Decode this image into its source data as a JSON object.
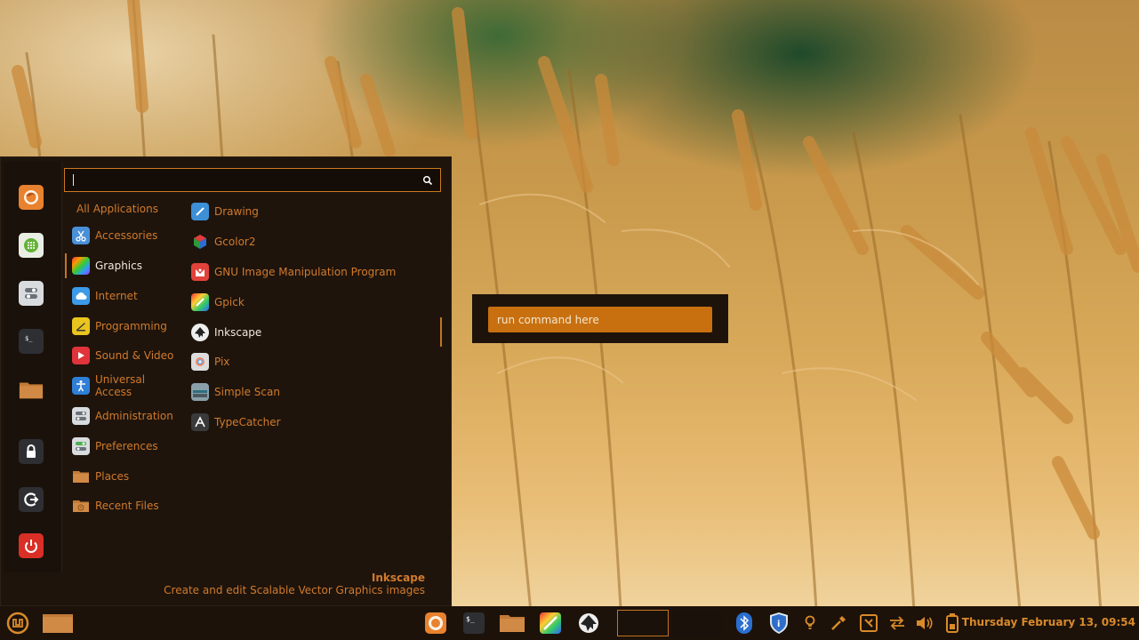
{
  "menu": {
    "search": {
      "value": "",
      "placeholder": ""
    },
    "categories": [
      {
        "label": "All Applications",
        "icon": "none",
        "active": false
      },
      {
        "label": "Accessories",
        "icon": "scissors-icon",
        "active": false
      },
      {
        "label": "Graphics",
        "icon": "graphics-icon",
        "active": true
      },
      {
        "label": "Internet",
        "icon": "cloud-icon",
        "active": false
      },
      {
        "label": "Programming",
        "icon": "programming-icon",
        "active": false
      },
      {
        "label": "Sound & Video",
        "icon": "play-icon",
        "active": false
      },
      {
        "label": "Universal Access",
        "icon": "accessibility-icon",
        "active": false
      },
      {
        "label": "Administration",
        "icon": "admin-toggles-icon",
        "active": false
      },
      {
        "label": "Preferences",
        "icon": "preferences-toggles-icon",
        "active": false
      },
      {
        "label": "Places",
        "icon": "folder-icon",
        "active": false
      },
      {
        "label": "Recent Files",
        "icon": "recent-folder-icon",
        "active": false
      }
    ],
    "apps": [
      {
        "label": "Drawing",
        "icon": "drawing-icon"
      },
      {
        "label": "Gcolor2",
        "icon": "gcolor2-cube-icon"
      },
      {
        "label": "GNU Image Manipulation Program",
        "icon": "gimp-icon"
      },
      {
        "label": "Gpick",
        "icon": "gpick-icon"
      },
      {
        "label": "Inkscape",
        "icon": "inkscape-icon",
        "selected": true
      },
      {
        "label": "Pix",
        "icon": "pix-icon"
      },
      {
        "label": "Simple Scan",
        "icon": "scanner-icon"
      },
      {
        "label": "TypeCatcher",
        "icon": "typecatcher-icon"
      }
    ],
    "favorites": [
      "firefox-icon",
      "software-manager-icon",
      "system-settings-icon",
      "terminal-icon",
      "files-folder-icon",
      "lock-screen-icon",
      "logout-icon",
      "shutdown-icon"
    ],
    "description": {
      "name": "Inkscape",
      "text": "Create and edit Scalable Vector Graphics images"
    }
  },
  "run_dialog": {
    "placeholder": "run command here"
  },
  "panel": {
    "clock": "Thursday February 13, 09:54",
    "launchers": [
      "menu-mint-icon",
      "show-desktop-folder-icon",
      "firefox-icon",
      "terminal-icon",
      "files-folder-icon",
      "color-app-icon",
      "inkscape-icon"
    ],
    "tray": [
      "bluetooth-icon",
      "update-shield-icon",
      "redshift-bulb-icon",
      "color-picker-icon",
      "screenshot-icon",
      "network-arrows-icon",
      "volume-icon",
      "battery-icon"
    ]
  },
  "colors": {
    "accent": "#c8700f",
    "menu_bg": "#1e140c",
    "text_orange": "#d17a2c",
    "text_active": "#f1e7dd"
  }
}
